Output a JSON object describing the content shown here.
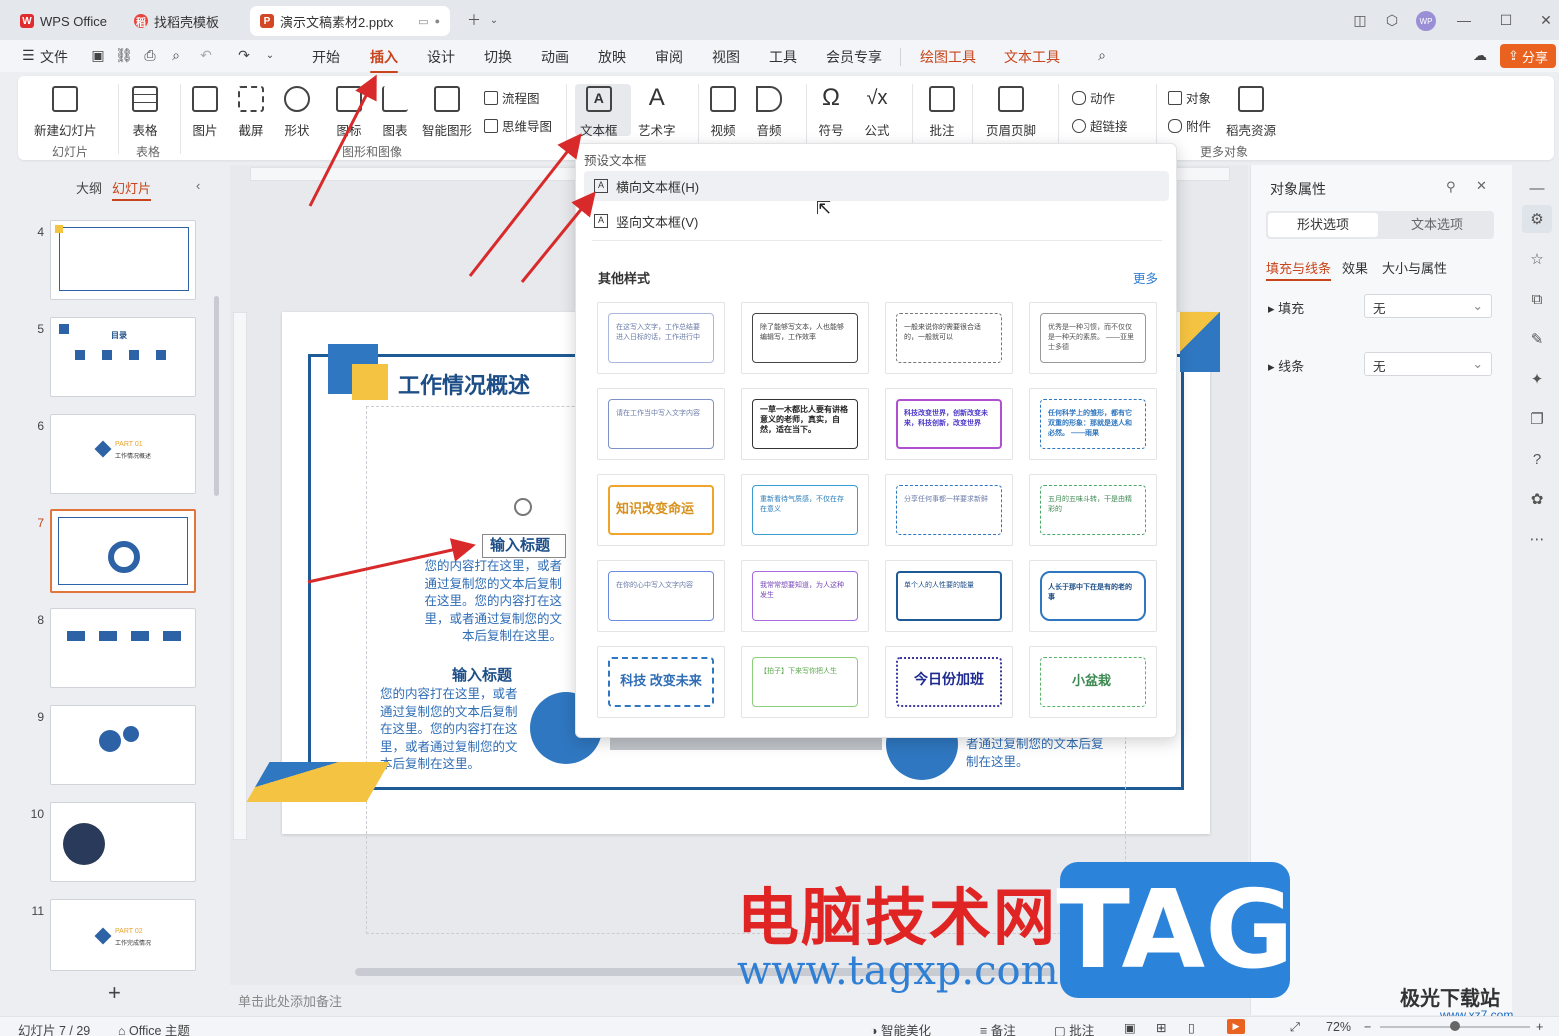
{
  "tabs": [
    {
      "label": "WPS Office",
      "icon": "wps-logo-icon"
    },
    {
      "label": "找稻壳模板",
      "icon": "docer-icon"
    },
    {
      "label": "演示文稿素材2.pptx",
      "icon": "ppt-file-icon"
    }
  ],
  "avatar": "WP",
  "menu": {
    "file": "文件",
    "items": [
      "开始",
      "插入",
      "设计",
      "切换",
      "动画",
      "放映",
      "审阅",
      "视图",
      "工具",
      "会员专享"
    ],
    "context": [
      "绘图工具",
      "文本工具"
    ],
    "active": "插入",
    "share": "分享"
  },
  "ribbon": {
    "new_slide": "新建幻灯片",
    "table": "表格",
    "picture": "图片",
    "screenshot": "截屏",
    "shape": "形状",
    "icon": "图标",
    "chart": "图表",
    "smartart": "智能图形",
    "flowchart": "流程图",
    "mindmap": "思维导图",
    "textbox": "文本框",
    "wordart": "艺术字",
    "video": "视频",
    "audio": "音频",
    "symbol": "符号",
    "formula": "公式",
    "comment": "批注",
    "header_footer": "页眉页脚",
    "action": "动作",
    "hyperlink": "超链接",
    "object": "对象",
    "attachment": "附件",
    "docer": "稻壳资源",
    "groups": {
      "slides": "幻灯片",
      "table": "表格",
      "graphics": "图形和图像",
      "more": "更多对象"
    }
  },
  "dropdown": {
    "preset_header": "预设文本框",
    "horizontal": "横向文本框(H)",
    "vertical": "竖向文本框(V)",
    "other_styles": "其他样式",
    "more": "更多",
    "cards": [
      {
        "text": "在这写入文字，工作总结要进入日标的话，工作进行中"
      },
      {
        "text": "除了能够写文本，人也能够编辑写，工作效率"
      },
      {
        "text": "一般来说你的需要很合适的，一般就可以"
      },
      {
        "text": "优秀是一种习惯，而不仅仅是一种天的素质。 ——亚里士多德"
      },
      {
        "text": "请在工作当中写入文字内容"
      },
      {
        "text": "一草一木都比人要有讲格意义的老师，真实，自然，适在当下。"
      },
      {
        "text": "科技改变世界，创新改变未来，科技创新，改变世界"
      },
      {
        "text": "任何科学上的雏形，都有它双重的形象：那就是迷人和必然。 ——雨果"
      },
      {
        "text": "知识改变命运"
      },
      {
        "text": "重新看待气质感，不仅在存在意义"
      },
      {
        "text": "分享任何事都一样要求新鲜"
      },
      {
        "text": "五月的五味斗转，干是由精彩的"
      },
      {
        "text": "在你的心中写入文字内容"
      },
      {
        "text": "我常常想要知道，为人这种发生"
      },
      {
        "text": "单个人的人性要的能量"
      },
      {
        "text": "人长于那中下在是有的老的事"
      },
      {
        "text": "科技 改变未来"
      },
      {
        "text": "【拍子】下来写你把人生"
      },
      {
        "text": "今日份加班"
      },
      {
        "text": "小盆栽"
      }
    ]
  },
  "slides": {
    "outline_tab": "大纲",
    "slides_tab": "幻灯片",
    "numbers": [
      "4",
      "5",
      "6",
      "7",
      "8",
      "9",
      "10",
      "11"
    ],
    "thumb5_title": "目录",
    "thumb6_part": "PART 01",
    "thumb6_sub": "工作情况概述",
    "thumb11_part": "PART 02",
    "thumb11_sub": "工作完成情况",
    "add": "+"
  },
  "slide_content": {
    "title": "工作情况概述",
    "heading1": "输入标题",
    "body1": "您的内容打在这里，或者通过复制您的文本后复制在这里。您的内容打在这里，或者通过复制您的文本后复制在这里。",
    "heading2": "输入标题",
    "body2": "您的内容打在这里，或者通过复制您的文本后复制在这里。您的内容打在这里，或者通过复制您的文本后复制在这里。",
    "body3": "者通过复制您的文本后复制在这里。"
  },
  "notes_placeholder": "单击此处添加备注",
  "right_panel": {
    "title": "对象属性",
    "tab_shape": "形状选项",
    "tab_text": "文本选项",
    "sub_fill_line": "填充与线条",
    "sub_effect": "效果",
    "sub_size": "大小与属性",
    "fill_label": "填充",
    "fill_value": "无",
    "line_label": "线条",
    "line_value": "无"
  },
  "status": {
    "slide": "幻灯片 7 / 29",
    "theme": "Office 主题",
    "beautify": "智能美化",
    "notes": "备注",
    "comment": "批注",
    "zoom": "72%"
  },
  "watermark": {
    "site_cn": "电脑技术网",
    "url": "www.tagxp.com",
    "tag": "TAG",
    "site2": "极光下载站",
    "url2": "www.xz7.com"
  },
  "colors": {
    "accent": "#c8441a",
    "slide_blue": "#1d5a96",
    "slide_yellow": "#f5c342",
    "arrow": "#d82a2a"
  }
}
